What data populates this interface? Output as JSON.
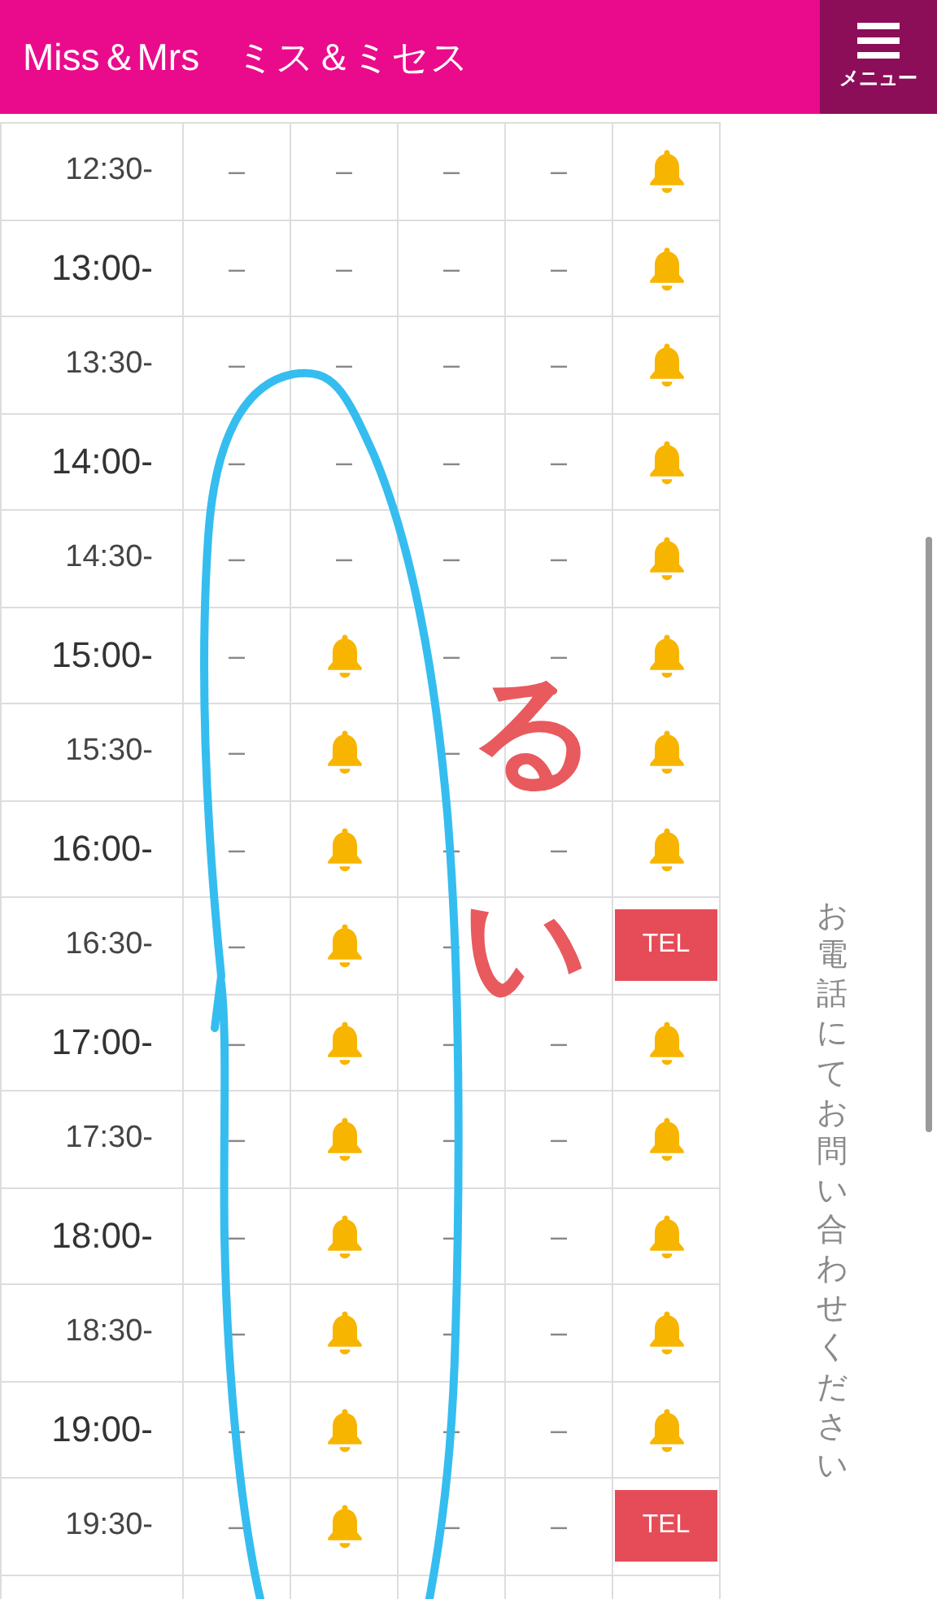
{
  "header": {
    "title": "Miss＆Mrs　ミス＆ミセス",
    "menu_label": "メニュー"
  },
  "rows": [
    {
      "time": "12:30-",
      "kind": "half",
      "cells": [
        {
          "kind": "dash",
          "text": "–"
        },
        {
          "kind": "dash",
          "text": "–"
        },
        {
          "kind": "dash",
          "text": "–"
        },
        {
          "kind": "dash",
          "text": "–"
        },
        {
          "kind": "bell"
        }
      ]
    },
    {
      "time": "13:00-",
      "kind": "hour",
      "cells": [
        {
          "kind": "dash",
          "text": "–"
        },
        {
          "kind": "dash",
          "text": "–"
        },
        {
          "kind": "dash",
          "text": "–"
        },
        {
          "kind": "dash",
          "text": "–"
        },
        {
          "kind": "bell"
        }
      ]
    },
    {
      "time": "13:30-",
      "kind": "half",
      "cells": [
        {
          "kind": "dash",
          "text": "–"
        },
        {
          "kind": "dash",
          "text": "–"
        },
        {
          "kind": "dash",
          "text": "–"
        },
        {
          "kind": "dash",
          "text": "–"
        },
        {
          "kind": "bell"
        }
      ]
    },
    {
      "time": "14:00-",
      "kind": "hour",
      "cells": [
        {
          "kind": "dash",
          "text": "–"
        },
        {
          "kind": "dash",
          "text": "–"
        },
        {
          "kind": "dash",
          "text": "–"
        },
        {
          "kind": "dash",
          "text": "–"
        },
        {
          "kind": "bell"
        }
      ]
    },
    {
      "time": "14:30-",
      "kind": "half",
      "cells": [
        {
          "kind": "dash",
          "text": "–"
        },
        {
          "kind": "dash",
          "text": "–"
        },
        {
          "kind": "dash",
          "text": "–"
        },
        {
          "kind": "dash",
          "text": "–"
        },
        {
          "kind": "bell"
        }
      ]
    },
    {
      "time": "15:00-",
      "kind": "hour",
      "cells": [
        {
          "kind": "dash",
          "text": "–"
        },
        {
          "kind": "bell"
        },
        {
          "kind": "dash",
          "text": "–"
        },
        {
          "kind": "dash",
          "text": "–"
        },
        {
          "kind": "bell"
        }
      ]
    },
    {
      "time": "15:30-",
      "kind": "half",
      "cells": [
        {
          "kind": "dash",
          "text": "–"
        },
        {
          "kind": "bell"
        },
        {
          "kind": "dash",
          "text": "–"
        },
        {
          "kind": "blank"
        },
        {
          "kind": "bell"
        }
      ]
    },
    {
      "time": "16:00-",
      "kind": "hour",
      "cells": [
        {
          "kind": "dash",
          "text": "–"
        },
        {
          "kind": "bell"
        },
        {
          "kind": "dash",
          "text": "–"
        },
        {
          "kind": "dash",
          "text": "–"
        },
        {
          "kind": "bell"
        }
      ]
    },
    {
      "time": "16:30-",
      "kind": "half",
      "cells": [
        {
          "kind": "dash",
          "text": "–"
        },
        {
          "kind": "bell"
        },
        {
          "kind": "dash",
          "text": "–"
        },
        {
          "kind": "blank"
        },
        {
          "kind": "tel",
          "text": "TEL"
        }
      ]
    },
    {
      "time": "17:00-",
      "kind": "hour",
      "cells": [
        {
          "kind": "dash",
          "text": "–"
        },
        {
          "kind": "bell"
        },
        {
          "kind": "dash",
          "text": "–"
        },
        {
          "kind": "dash",
          "text": "–"
        },
        {
          "kind": "bell"
        }
      ]
    },
    {
      "time": "17:30-",
      "kind": "half",
      "cells": [
        {
          "kind": "dash",
          "text": "–"
        },
        {
          "kind": "bell"
        },
        {
          "kind": "dash",
          "text": "–"
        },
        {
          "kind": "dash",
          "text": "–"
        },
        {
          "kind": "bell"
        }
      ]
    },
    {
      "time": "18:00-",
      "kind": "hour",
      "cells": [
        {
          "kind": "dash",
          "text": "–"
        },
        {
          "kind": "bell"
        },
        {
          "kind": "dash",
          "text": "–"
        },
        {
          "kind": "dash",
          "text": "–"
        },
        {
          "kind": "bell"
        }
      ]
    },
    {
      "time": "18:30-",
      "kind": "half",
      "cells": [
        {
          "kind": "dash",
          "text": "–"
        },
        {
          "kind": "bell"
        },
        {
          "kind": "dash",
          "text": "–"
        },
        {
          "kind": "dash",
          "text": "–"
        },
        {
          "kind": "bell"
        }
      ]
    },
    {
      "time": "19:00-",
      "kind": "hour",
      "cells": [
        {
          "kind": "dash",
          "text": "–"
        },
        {
          "kind": "bell"
        },
        {
          "kind": "dash",
          "text": "–"
        },
        {
          "kind": "dash",
          "text": "–"
        },
        {
          "kind": "bell"
        }
      ]
    },
    {
      "time": "19:30-",
      "kind": "half",
      "cells": [
        {
          "kind": "dash",
          "text": "–"
        },
        {
          "kind": "bell"
        },
        {
          "kind": "dash",
          "text": "–"
        },
        {
          "kind": "dash",
          "text": "–"
        },
        {
          "kind": "tel",
          "text": "TEL"
        }
      ]
    }
  ],
  "side_note": "お電話にてお問い合わせください",
  "annotation": {
    "marks": [
      "る",
      "い"
    ]
  }
}
